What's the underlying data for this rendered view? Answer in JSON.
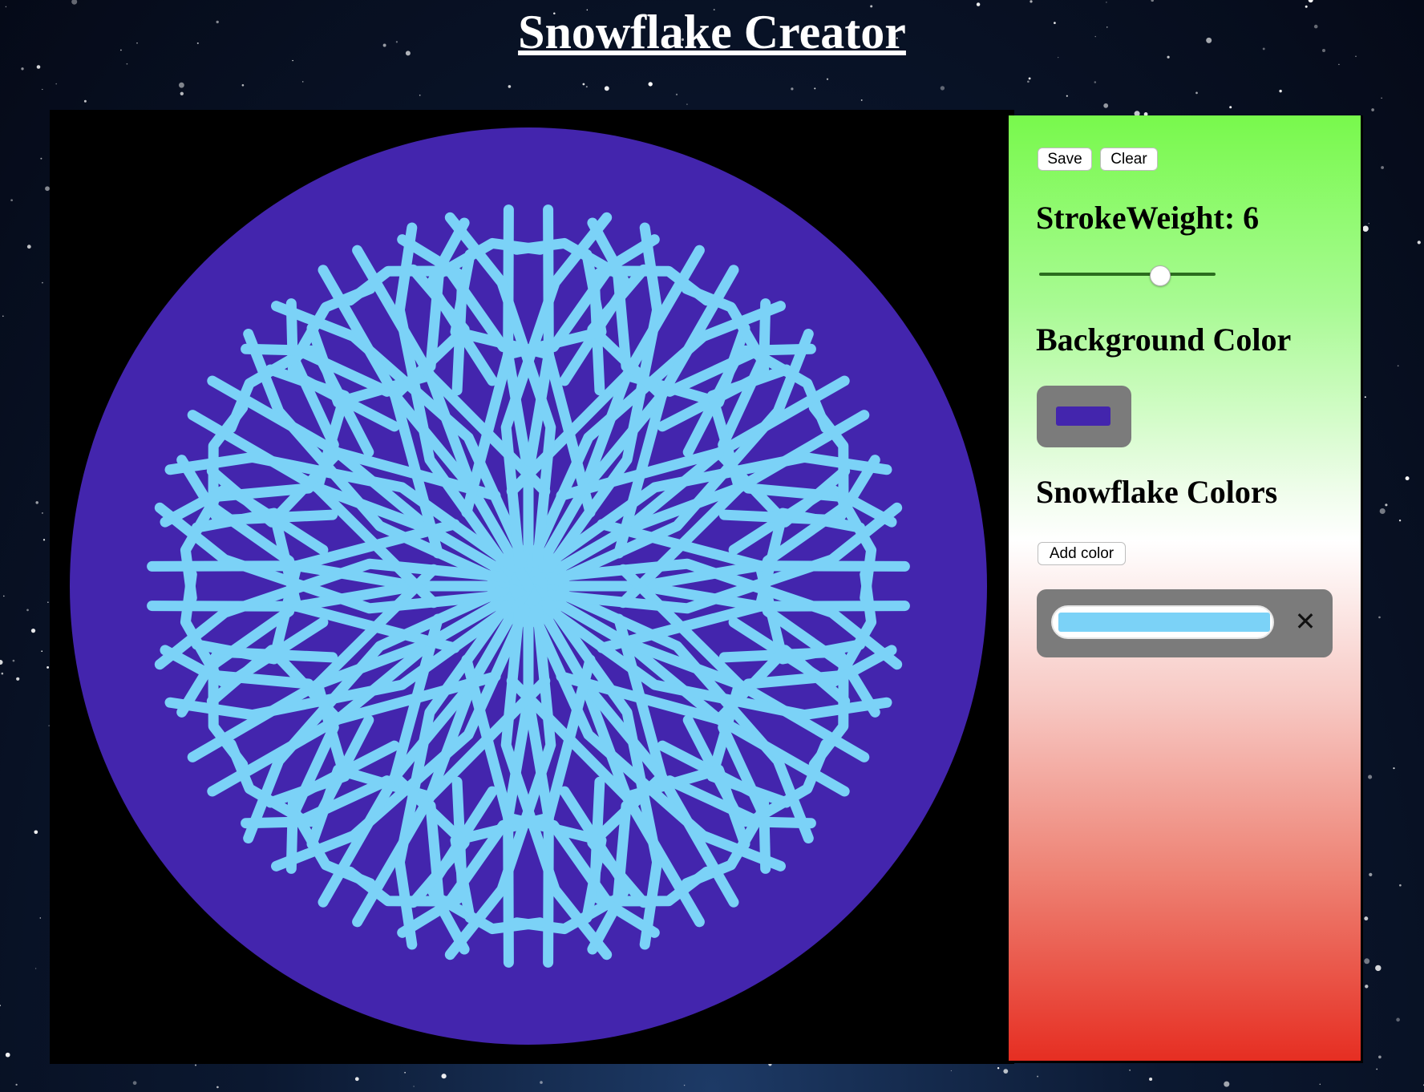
{
  "page": {
    "title": "Snowflake Creator"
  },
  "colors": {
    "background_color": "#4325ad",
    "snowflake_color": "#7bd2f7",
    "panel_top": "#78f94c",
    "panel_bottom": "#e62e22"
  },
  "controls": {
    "save_label": "Save",
    "clear_label": "Clear",
    "stroke_weight_label": "StrokeWeight: 6",
    "stroke_weight_value": 6,
    "stroke_weight_slider_fraction": 0.68,
    "background_color_label": "Background Color",
    "snowflake_colors_label": "Snowflake Colors",
    "add_color_label": "Add color",
    "remove_color_icon": "close-icon"
  }
}
